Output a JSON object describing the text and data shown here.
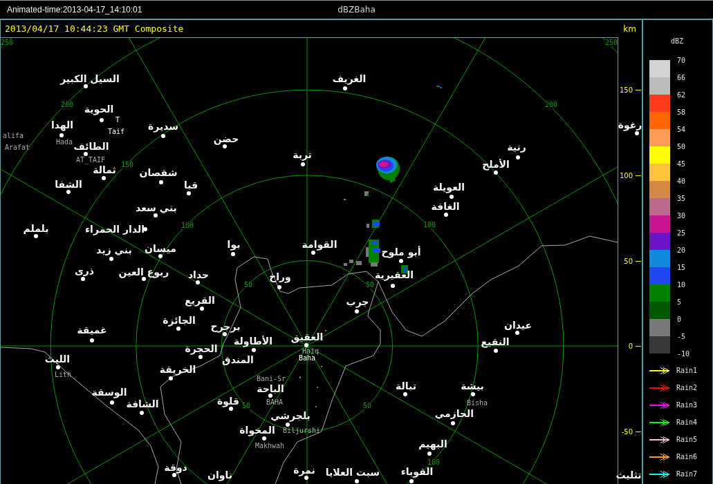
{
  "title_bar": {
    "animated_time": "Animated-time:2013-04-17_14:10:01",
    "product": "dBZBaha"
  },
  "plot": {
    "timestamp": "2013/04/17 10:44:23 GMT Composite",
    "unit": "km",
    "axis_ticks": [
      "150",
      "100",
      "50",
      "0",
      "-50"
    ],
    "range_labels": [
      "250",
      "250",
      "200",
      "200",
      "150",
      "100",
      "100",
      "50",
      "50",
      "50",
      "50",
      "100"
    ],
    "places": [
      {
        "name": "الغريف"
      },
      {
        "name": "السيل الكبير"
      },
      {
        "name": "الحوية"
      },
      {
        "name": "رغوة"
      },
      {
        "name": "سديرة"
      },
      {
        "name": "الهدا"
      },
      {
        "name": "حضن"
      },
      {
        "name": "رنية"
      },
      {
        "name": "الطائف"
      },
      {
        "name": "تربة"
      },
      {
        "name": "الأملح"
      },
      {
        "name": "شقصان"
      },
      {
        "name": "ثمالة"
      },
      {
        "name": "العويلة"
      },
      {
        "name": "قبا"
      },
      {
        "name": "الشفا"
      },
      {
        "name": "الغافة"
      },
      {
        "name": "بني سعد"
      },
      {
        "name": "الدار الحمراء"
      },
      {
        "name": "بلملم"
      },
      {
        "name": "القوامة"
      },
      {
        "name": "بوا"
      },
      {
        "name": "أبو ملوح"
      },
      {
        "name": "ميسان"
      },
      {
        "name": "بني زيد"
      },
      {
        "name": "العقيرية"
      },
      {
        "name": "وراخ"
      },
      {
        "name": "حداد"
      },
      {
        "name": "ربوع العين"
      },
      {
        "name": "ذرى"
      },
      {
        "name": "جرب"
      },
      {
        "name": "القريع"
      },
      {
        "name": "الجائزة"
      },
      {
        "name": "عيدان"
      },
      {
        "name": "برجرح"
      },
      {
        "name": "غميقة"
      },
      {
        "name": "النقيع"
      },
      {
        "name": "العقيق"
      },
      {
        "name": "الأطاولة"
      },
      {
        "name": "الحجرة"
      },
      {
        "name": "المندق"
      },
      {
        "name": "الليث"
      },
      {
        "name": "الخريقة"
      },
      {
        "name": "بيشة"
      },
      {
        "name": "تبالة"
      },
      {
        "name": "الباحة"
      },
      {
        "name": "الوسقة"
      },
      {
        "name": "قلوة"
      },
      {
        "name": "الشافة"
      },
      {
        "name": "الحازمي"
      },
      {
        "name": "بلجرشي"
      },
      {
        "name": "المخواة"
      },
      {
        "name": "البهيم"
      },
      {
        "name": "تثليث"
      },
      {
        "name": "القوباء"
      },
      {
        "name": "سبت العلايا"
      },
      {
        "name": "نمرة"
      },
      {
        "name": "ناوان"
      },
      {
        "name": "دوقة"
      }
    ],
    "site_labels": [
      {
        "text": "T",
        "kind": "radar"
      },
      {
        "text": "alifa",
        "kind": "station"
      },
      {
        "text": "Taif",
        "kind": "radar"
      },
      {
        "text": "Hada",
        "kind": "station"
      },
      {
        "text": "Arafat",
        "kind": "station"
      },
      {
        "text": "AT_TAIF",
        "kind": "station"
      },
      {
        "text": "Haiq",
        "kind": "station"
      },
      {
        "text": "Baha",
        "kind": "radar"
      },
      {
        "text": "Lith",
        "kind": "station"
      },
      {
        "text": "Bani-Sr",
        "kind": "station"
      },
      {
        "text": "BAHA",
        "kind": "station"
      },
      {
        "text": "Bisha",
        "kind": "station"
      },
      {
        "text": "Biljurshi",
        "kind": "station"
      },
      {
        "text": "Makhwah",
        "kind": "station"
      }
    ]
  },
  "legend": {
    "unit": "dBZ",
    "bins": [
      {
        "color": "#d2d2d2"
      },
      {
        "color": "#bcbcbc"
      },
      {
        "color": "#ff3b1e"
      },
      {
        "color": "#ff6600"
      },
      {
        "color": "#ff9a5a"
      },
      {
        "color": "#ffff00"
      },
      {
        "color": "#fcc43c"
      },
      {
        "color": "#d48a44"
      },
      {
        "color": "#bc6a8c"
      },
      {
        "color": "#c81490"
      },
      {
        "color": "#6c14c8"
      },
      {
        "color": "#1488dc"
      },
      {
        "color": "#2048f0"
      },
      {
        "color": "#008000"
      },
      {
        "color": "#005800"
      },
      {
        "color": "#787878"
      },
      {
        "color": "#383838"
      }
    ],
    "bin_labels": [
      "70",
      "66",
      "62",
      "58",
      "54",
      "50",
      "45",
      "40",
      "35",
      "30",
      "25",
      "20",
      "15",
      "10",
      "5",
      "0",
      "-5",
      "-10"
    ],
    "tracks": [
      {
        "label": "Rain1",
        "color": "#ffff00"
      },
      {
        "label": "Rain2",
        "color": "#ff0000"
      },
      {
        "label": "Rain3",
        "color": "#ff00ff"
      },
      {
        "label": "Rain4",
        "color": "#00ff00"
      },
      {
        "label": "Rain5",
        "color": "#ffc0cb"
      },
      {
        "label": "Rain6",
        "color": "#ffa500"
      },
      {
        "label": "Rain7",
        "color": "#00ffff"
      }
    ]
  }
}
